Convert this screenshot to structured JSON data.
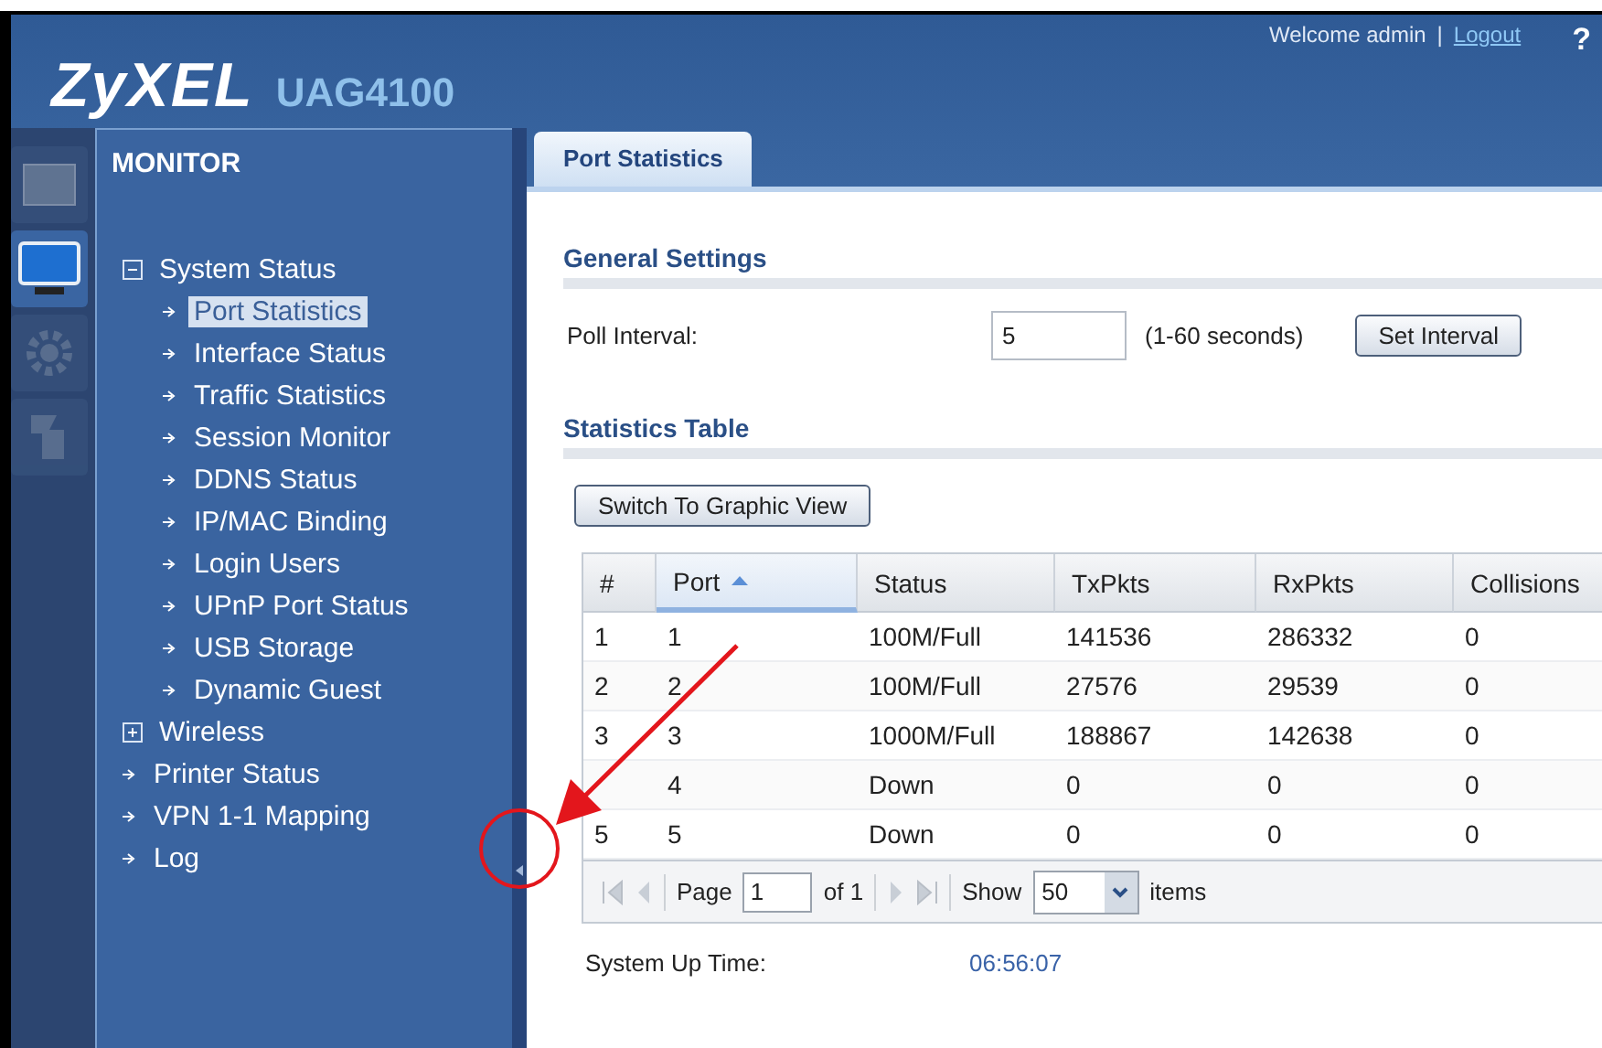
{
  "header": {
    "brand": "ZyXEL",
    "model": "UAG4100",
    "welcome": "Welcome admin",
    "separator": "|",
    "logout": "Logout",
    "help": "?"
  },
  "mode_icons": [
    {
      "kind": "dashboard",
      "selected": false
    },
    {
      "kind": "monitor",
      "selected": true
    },
    {
      "kind": "configuration",
      "selected": false
    },
    {
      "kind": "maintenance",
      "selected": false
    }
  ],
  "sidebar": {
    "title": "MONITOR",
    "items": [
      {
        "label": "System Status",
        "kind": "group",
        "expanded": true,
        "selected": false,
        "children": [
          {
            "label": "Port Statistics",
            "kind": "leaf",
            "selected": true
          },
          {
            "label": "Interface Status",
            "kind": "leaf",
            "selected": false
          },
          {
            "label": "Traffic Statistics",
            "kind": "leaf",
            "selected": false
          },
          {
            "label": "Session Monitor",
            "kind": "leaf",
            "selected": false
          },
          {
            "label": "DDNS Status",
            "kind": "leaf",
            "selected": false
          },
          {
            "label": "IP/MAC Binding",
            "kind": "leaf",
            "selected": false
          },
          {
            "label": "Login Users",
            "kind": "leaf",
            "selected": false
          },
          {
            "label": "UPnP Port Status",
            "kind": "leaf",
            "selected": false
          },
          {
            "label": "USB Storage",
            "kind": "leaf",
            "selected": false
          },
          {
            "label": "Dynamic Guest",
            "kind": "leaf",
            "selected": false
          }
        ]
      },
      {
        "label": "Wireless",
        "kind": "group",
        "expanded": false,
        "selected": false
      },
      {
        "label": "Printer Status",
        "kind": "leaf",
        "selected": false
      },
      {
        "label": "VPN 1-1 Mapping",
        "kind": "leaf",
        "selected": false
      },
      {
        "label": "Log",
        "kind": "leaf",
        "selected": false
      }
    ]
  },
  "tabs": [
    {
      "label": "Port Statistics",
      "selected": true
    }
  ],
  "general_settings": {
    "title": "General Settings",
    "poll_label": "Poll Interval:",
    "poll_value": "5",
    "poll_hint": "(1-60 seconds)",
    "button": "Set Interval"
  },
  "statistics": {
    "title": "Statistics Table",
    "view_button": "Switch To Graphic View",
    "columns": [
      {
        "label": "#",
        "sorted": false
      },
      {
        "label": "Port",
        "sorted": true
      },
      {
        "label": "Status",
        "sorted": false
      },
      {
        "label": "TxPkts",
        "sorted": false
      },
      {
        "label": "RxPkts",
        "sorted": false
      },
      {
        "label": "Collisions",
        "sorted": false
      }
    ],
    "rows": [
      [
        "1",
        "1",
        "100M/Full",
        "141536",
        "286332",
        "0"
      ],
      [
        "2",
        "2",
        "100M/Full",
        "27576",
        "29539",
        "0"
      ],
      [
        "3",
        "3",
        "1000M/Full",
        "188867",
        "142638",
        "0"
      ],
      [
        "",
        "4",
        "Down",
        "0",
        "0",
        "0"
      ],
      [
        "5",
        "5",
        "Down",
        "0",
        "0",
        "0"
      ]
    ],
    "pager": {
      "page_label": "Page",
      "page": "1",
      "of": "of 1",
      "show_label": "Show",
      "show": "50",
      "items_label": "items"
    }
  },
  "uptime": {
    "label": "System Up Time:",
    "value": "06:56:07"
  }
}
